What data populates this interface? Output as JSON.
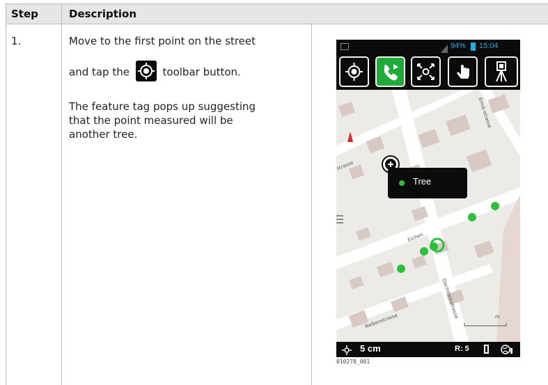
{
  "table": {
    "headers": {
      "step": "Step",
      "description": "Description"
    },
    "rows": [
      {
        "step": "1.",
        "text1": "Move to the first point on the street",
        "text2_pre": "and tap the",
        "text2_post": "toolbar button.",
        "text3_line1": "The feature tag pops up suggesting",
        "text3_line2": "that the point measured will be",
        "text3_line3": "another tree."
      }
    ]
  },
  "screenshot": {
    "status": {
      "battery": "94%",
      "time": "15:04"
    },
    "toolbar": [
      "target-icon",
      "phone-play-icon",
      "zoom-to-point-icon",
      "tap-hand-icon",
      "total-station-icon"
    ],
    "map": {
      "street_labels": [
        "strasse",
        "Eichen",
        "Dachsteinstrasse",
        "Nelkenstrasse",
        "Ernst-strasse"
      ],
      "popup_label": "Tree",
      "scale_label": "m"
    },
    "bottom": {
      "precision": "5 cm",
      "r_label": "R: 5"
    },
    "caption": "010278_001",
    "colors": {
      "accent": "#1faa3a",
      "status": "#2aa8e0",
      "map_bg": "#ecebe7",
      "building": "#d9c9c5"
    }
  }
}
